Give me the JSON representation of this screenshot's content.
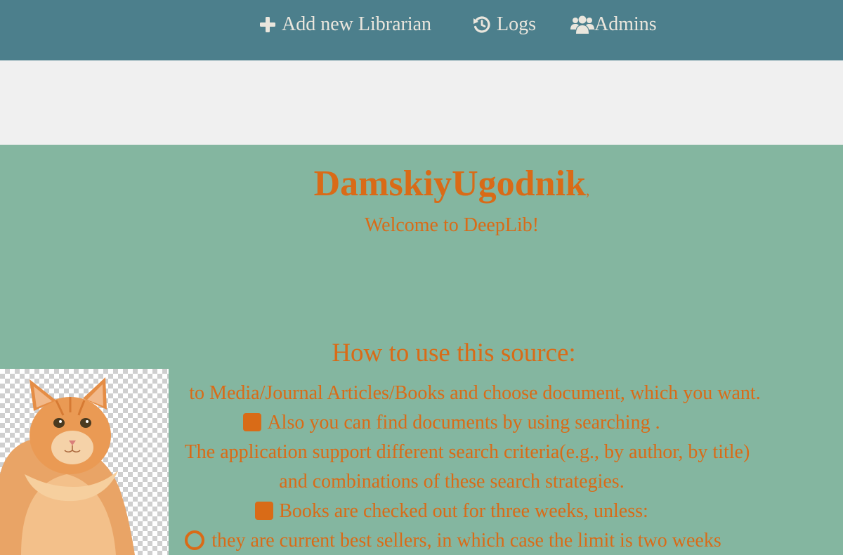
{
  "nav": {
    "items": [
      {
        "label": "Add new Librarian",
        "icon": "plus-icon"
      },
      {
        "label": "Logs",
        "icon": "history-icon"
      },
      {
        "label": "Admins",
        "icon": "users-icon"
      }
    ]
  },
  "greeting": {
    "name": "DamskiyUgodnik",
    "comma": ",",
    "welcome": "Welcome to DeepLib!"
  },
  "howto": {
    "heading": "How to use this source:",
    "lines": [
      "to Media/Journal Articles/Books and choose document, which you want.",
      "Also you can find documents by using searching .",
      "The application support different search criteria(e.g., by author, by title)",
      "and combinations of these search strategies.",
      "Books are checked out for three weeks, unless:",
      "they are current best sellers, in which case the limit is two weeks"
    ]
  },
  "image": {
    "alt": "cat-photo"
  },
  "colors": {
    "topbar": "#4c7f8c",
    "nav_text": "#eae6dd",
    "main_bg": "#84b6a0",
    "accent": "#d96b17",
    "band": "#f0f0f0"
  }
}
